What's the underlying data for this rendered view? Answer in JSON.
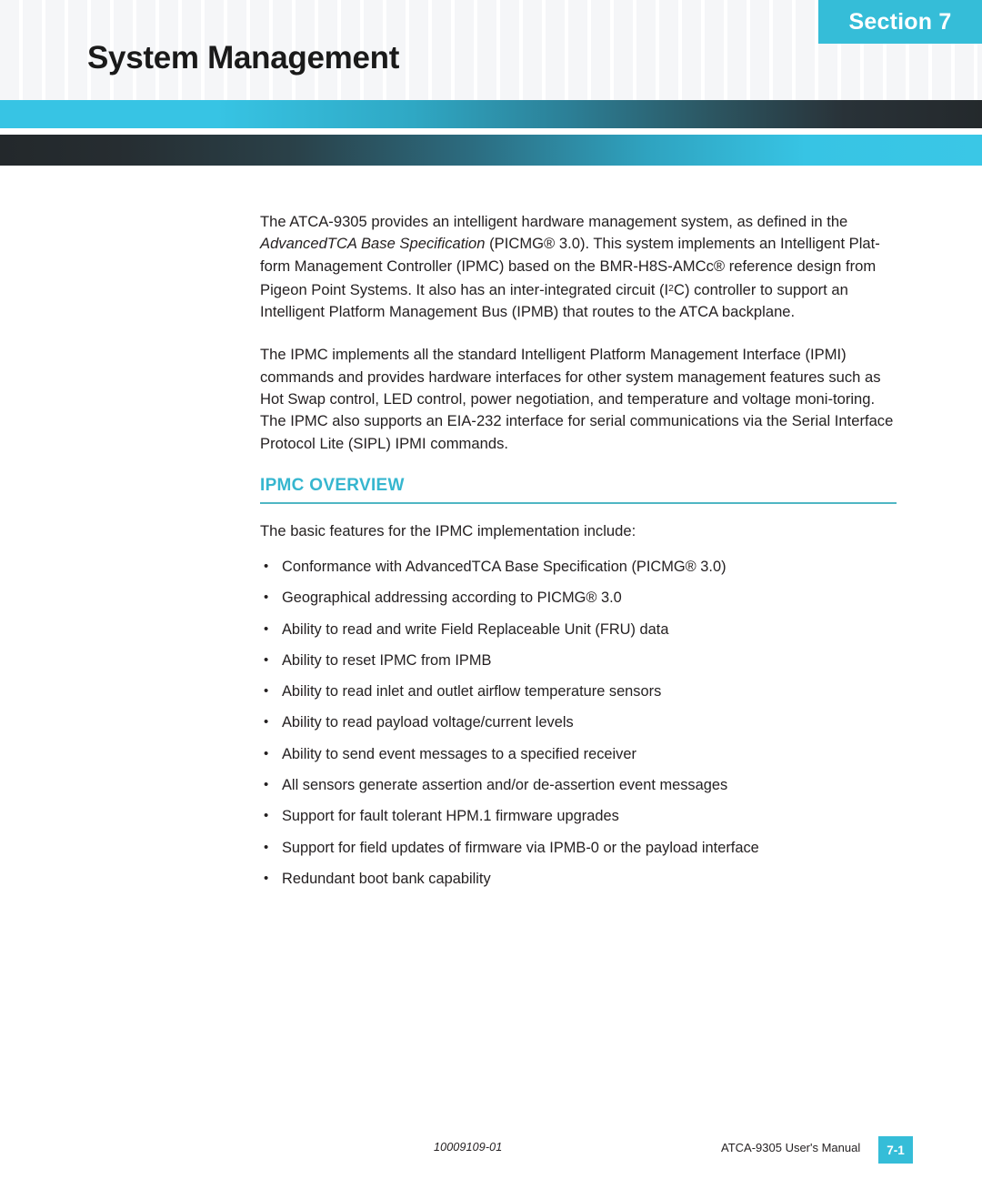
{
  "header": {
    "section_badge": "Section 7",
    "title": "System Management"
  },
  "colors": {
    "accent_cyan": "#35bdd8",
    "heading_teal": "#36b6cf",
    "rule_teal": "#4fb6c4",
    "bar_dark": "#23282b",
    "text": "#231f20"
  },
  "body": {
    "paragraph_1": {
      "part_1": "The ATCA-9305 provides an intelligent hardware management system, as defined in the ",
      "italic_title": "AdvancedTCA Base Specification",
      "part_2": " (PICMG® 3.0). This system implements an Intelligent Plat-form Management Controller (IPMC) based on the BMR-H8S-AMCc® reference design from Pigeon Point Systems. It also has an inter-integrated circuit (I",
      "superscript": "2",
      "part_3": "C) controller to support an Intelligent Platform Management Bus (IPMB) that routes to the ATCA backplane."
    },
    "paragraph_2": "The IPMC implements all the standard Intelligent Platform Management Interface (IPMI) commands and provides hardware interfaces for other system management features such as Hot Swap control, LED control, power negotiation, and temperature and voltage moni-toring. The IPMC also supports an EIA-232 interface for serial communications via the Serial Interface Protocol Lite (SIPL) IPMI commands."
  },
  "ipmc_section": {
    "heading": "IPMC OVERVIEW",
    "lead_in": "The basic features for the IPMC implementation include:",
    "features": [
      "Conformance with AdvancedTCA Base Specification (PICMG® 3.0)",
      "Geographical addressing according to PICMG® 3.0",
      "Ability to read and write Field Replaceable Unit (FRU) data",
      "Ability to reset IPMC from IPMB",
      "Ability to read inlet and outlet airflow temperature sensors",
      "Ability to read payload voltage/current levels",
      "Ability to send event messages to a specified receiver",
      "All sensors generate assertion and/or de-assertion event messages",
      "Support for fault tolerant HPM.1 firmware upgrades",
      "Support for field updates of firmware via IPMB-0 or the payload interface",
      "Redundant boot bank capability"
    ]
  },
  "footer": {
    "document_number": "10009109-01",
    "manual_name": "ATCA-9305 User's Manual",
    "page_number": "7-1"
  }
}
